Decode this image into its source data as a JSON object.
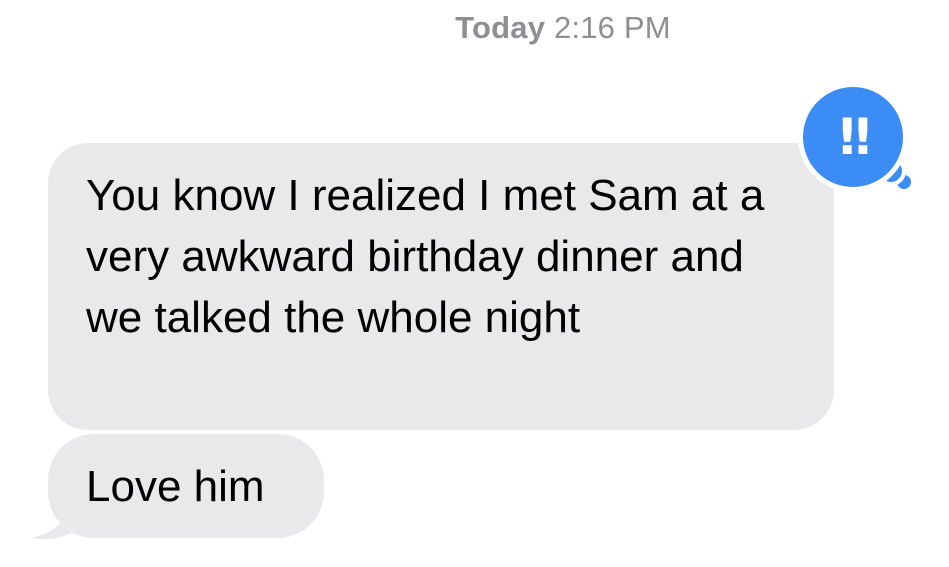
{
  "header": {
    "day_label": "Today",
    "time_label": "2:16 PM"
  },
  "messages": [
    {
      "text": "You know I realized I met Sam at a very awkward birthday dinner and we talked the whole night",
      "direction": "incoming",
      "reaction": {
        "name": "exclamation-reaction",
        "glyph": "‼"
      }
    },
    {
      "text": "Love him",
      "direction": "incoming"
    }
  ],
  "colors": {
    "incoming_bubble": "#e9e9eb",
    "reaction_blue": "#3b8cf5",
    "timestamp_gray": "#8e8e93",
    "text": "#000000"
  }
}
